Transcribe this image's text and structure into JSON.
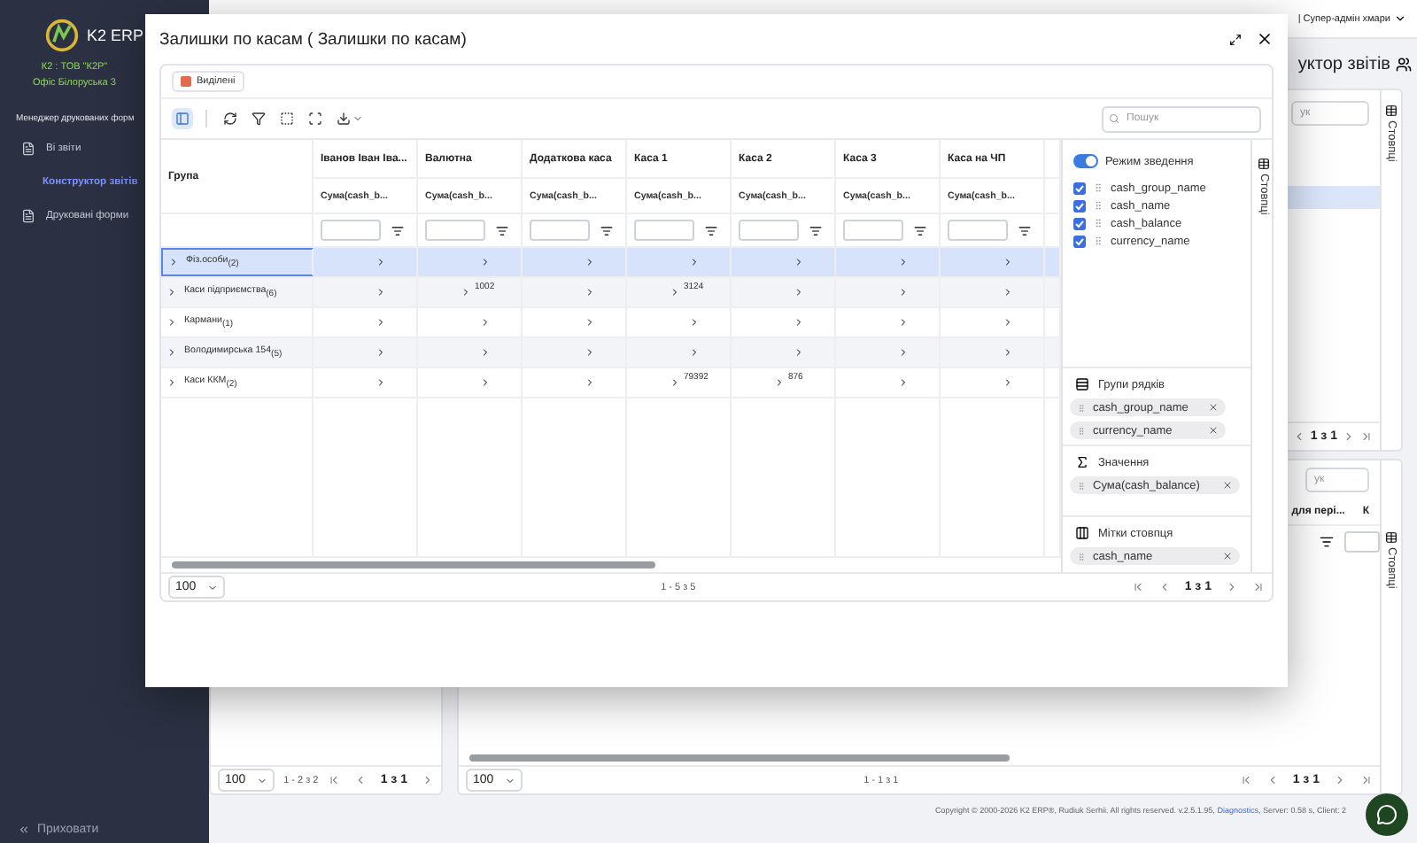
{
  "sidebar": {
    "logo": "K2 ERP",
    "company": "К2 : ТОВ \"К2Р\"",
    "office": "Офіс Білоруська 3",
    "section": "Менеджер друкованих форм",
    "items": [
      {
        "label": "Ві звіти",
        "selected": false,
        "children": [
          {
            "label": "Конструктор звітів",
            "selected": true
          }
        ]
      },
      {
        "label": "Друковані форми",
        "selected": false
      }
    ],
    "hide": "Приховати"
  },
  "topbar": {
    "user": "| Супер-адмін хмари"
  },
  "page_title": "уктор звітів",
  "upper_grid": {
    "search_placeholder": "ук",
    "side_tab": "Стовпці",
    "page": "1 з 1"
  },
  "lower_left_grid": {
    "page_size": "100",
    "range": "1 - 2 з 2",
    "page": "1 з 1"
  },
  "lower_right_grid": {
    "search_placeholder": "ук",
    "columns": [
      "для пері...",
      "К"
    ],
    "side_tab": "Стовпці",
    "page_size": "100",
    "range": "1 - 1 з 1",
    "page": "1 з 1"
  },
  "copyright": {
    "text": "Copyright © 2000-2026 K2 ERP®, Rudiuk Serhii. All rights reserved. v.2.5.1.95,",
    "link": "Diagnostics",
    "rest": ", Server: 0.58 s, Client: 2"
  },
  "modal": {
    "title": "Залишки по касам ( Залишки по касам)",
    "chip": "Виділені",
    "pivot_view_active": true,
    "search_placeholder": "Пошук",
    "grid": {
      "group_header": "Група",
      "columns": [
        {
          "name": "Іванов Іван Іва...",
          "measure": "Сума(cash_b..."
        },
        {
          "name": "Валютна",
          "measure": "Сума(cash_b..."
        },
        {
          "name": "Додаткова каса",
          "measure": "Сума(cash_b..."
        },
        {
          "name": "Каса 1",
          "measure": "Сума(cash_b..."
        },
        {
          "name": "Каса 2",
          "measure": "Сума(cash_b..."
        },
        {
          "name": "Каса 3",
          "measure": "Сума(cash_b..."
        },
        {
          "name": "Каса на ЧП",
          "measure": "Сума(cash_b..."
        }
      ],
      "rows": [
        {
          "name": "Фіз.особи",
          "count": "(2)",
          "selected": true,
          "cells": [
            {
              "expandable": true
            },
            {
              "expandable": true
            },
            {
              "expandable": true
            },
            {
              "expandable": true
            },
            {
              "expandable": true
            },
            {
              "expandable": true
            },
            {
              "expandable": true
            }
          ]
        },
        {
          "name": "Каси підприємства",
          "count": "(6)",
          "selected": false,
          "cells": [
            {
              "expandable": true
            },
            {
              "expandable": true,
              "text": "1002"
            },
            {
              "expandable": true
            },
            {
              "expandable": true,
              "text": "3124"
            },
            {
              "expandable": true
            },
            {
              "expandable": true
            },
            {
              "expandable": true
            }
          ]
        },
        {
          "name": "Кармани",
          "count": "(1)",
          "selected": false,
          "cells": [
            {
              "expandable": true
            },
            {
              "expandable": true
            },
            {
              "expandable": true
            },
            {
              "expandable": true
            },
            {
              "expandable": true
            },
            {
              "expandable": true
            },
            {
              "expandable": true
            }
          ]
        },
        {
          "name": "Володимирська 154",
          "count": "(5)",
          "selected": false,
          "cells": [
            {
              "expandable": true
            },
            {
              "expandable": true
            },
            {
              "expandable": true
            },
            {
              "expandable": true
            },
            {
              "expandable": true
            },
            {
              "expandable": true
            },
            {
              "expandable": true
            }
          ]
        },
        {
          "name": "Каси ККМ",
          "count": "(2)",
          "selected": false,
          "cells": [
            {
              "expandable": true
            },
            {
              "expandable": true
            },
            {
              "expandable": true
            },
            {
              "expandable": true,
              "text": "79392"
            },
            {
              "expandable": true,
              "text": "876"
            },
            {
              "expandable": true
            },
            {
              "expandable": true
            }
          ]
        }
      ]
    },
    "pivot": {
      "mode_label": "Режим зведення",
      "mode_on": true,
      "fields": [
        {
          "name": "cash_group_name",
          "checked": true
        },
        {
          "name": "cash_name",
          "checked": true
        },
        {
          "name": "cash_balance",
          "checked": true
        },
        {
          "name": "currency_name",
          "checked": true
        }
      ],
      "sections": [
        {
          "kind": "rows",
          "title": "Групи рядків",
          "chips": [
            "cash_group_name",
            "currency_name"
          ]
        },
        {
          "kind": "values",
          "title": "Значення",
          "chips": [
            "Сума(cash_balance)"
          ]
        },
        {
          "kind": "columns",
          "title": "Мітки стовпця",
          "chips": [
            "cash_name"
          ]
        }
      ]
    },
    "side_tab": "Стовпці",
    "footer": {
      "page_size": "100",
      "range": "1 - 5 з 5",
      "page": "1 з 1"
    }
  }
}
